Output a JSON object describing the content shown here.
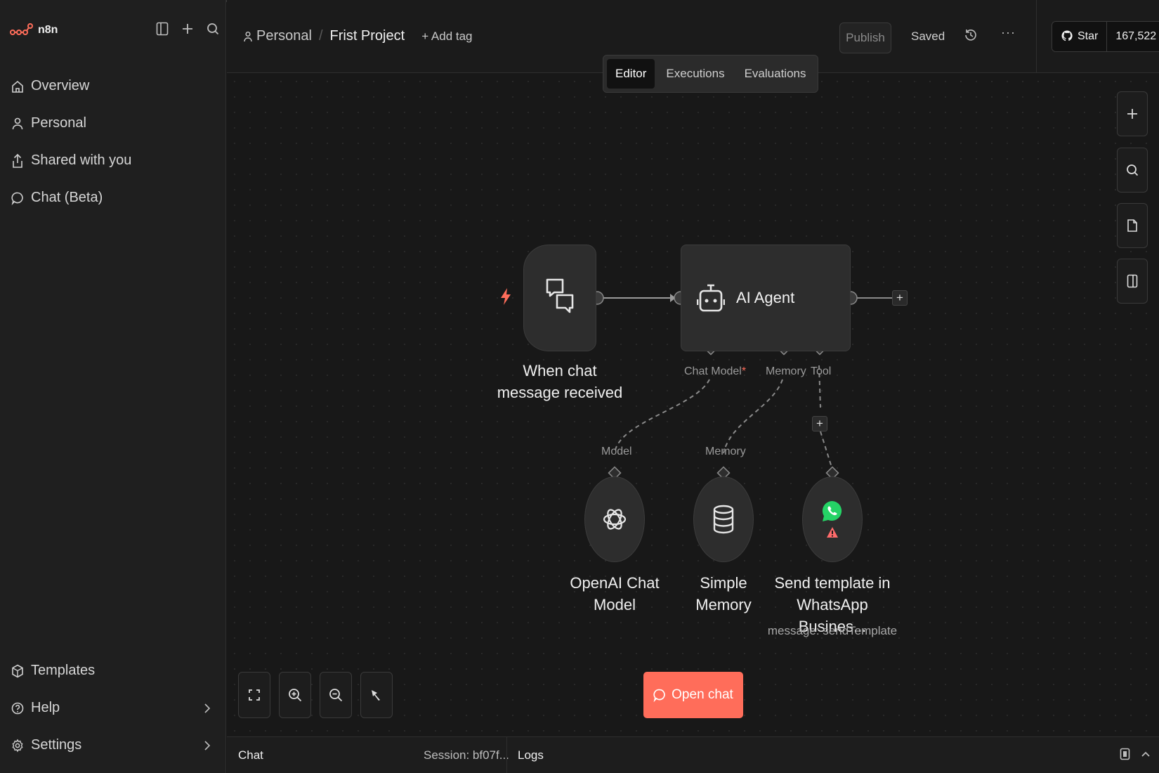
{
  "app": {
    "logo_text": "n8n"
  },
  "sidebar": {
    "items": [
      {
        "label": "Overview",
        "icon": "home-icon"
      },
      {
        "label": "Personal",
        "icon": "user-icon"
      },
      {
        "label": "Shared with you",
        "icon": "share-icon"
      },
      {
        "label": "Chat (Beta)",
        "icon": "chat-bubble-icon"
      }
    ],
    "bottom_items": [
      {
        "label": "Templates",
        "icon": "templates-icon"
      },
      {
        "label": "Help",
        "icon": "help-icon"
      },
      {
        "label": "Settings",
        "icon": "gear-icon"
      }
    ]
  },
  "header": {
    "breadcrumb_personal": "Personal",
    "breadcrumb_project": "Frist Project",
    "add_tag": "+ Add tag",
    "publish": "Publish",
    "saved": "Saved",
    "more": "···",
    "github_star": "Star",
    "github_count": "167,522"
  },
  "tabs": [
    {
      "label": "Editor",
      "active": true
    },
    {
      "label": "Executions",
      "active": false
    },
    {
      "label": "Evaluations",
      "active": false
    }
  ],
  "nodes": {
    "trigger": {
      "label": "When chat message received"
    },
    "agent": {
      "title": "AI Agent",
      "slot_chat_model": "Chat Model",
      "slot_required_mark": "*",
      "slot_memory": "Memory",
      "slot_tool": "Tool"
    },
    "openai": {
      "label": "OpenAI Chat Model",
      "input_label": "Model"
    },
    "memory": {
      "label": "Simple Memory",
      "input_label": "Memory"
    },
    "whatsapp": {
      "label_line1": "Send template in",
      "label_line2": "WhatsApp Busines...",
      "subtitle": "message: sendTemplate"
    }
  },
  "canvas": {
    "open_chat": "Open chat",
    "plus": "+"
  },
  "bottom_panel": {
    "chat": "Chat",
    "session": "Session: bf07f...",
    "logs": "Logs"
  },
  "colors": {
    "accent": "#ff6d5a",
    "whatsapp": "#25d366",
    "warning": "#ff6b6b"
  }
}
